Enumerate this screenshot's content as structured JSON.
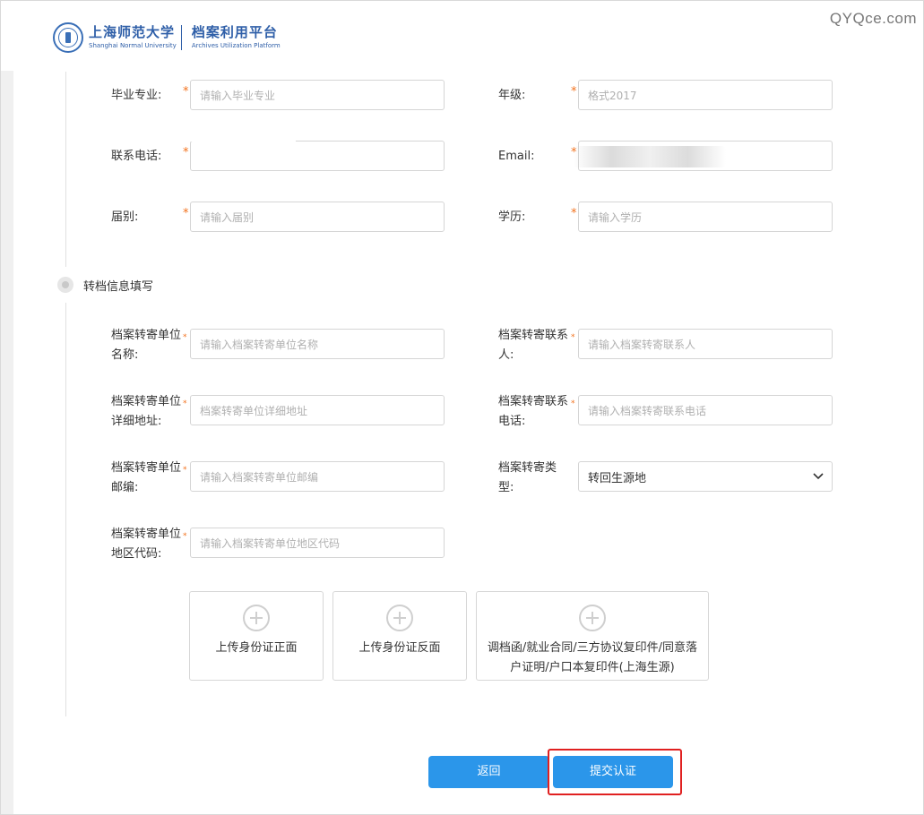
{
  "header": {
    "logo_cn": "上海师范大学",
    "platform_cn": "档案利用平台",
    "logo_en": "Shanghai Normal University",
    "platform_en": "Archives Utilization Platform",
    "watermark": "QYQce.com"
  },
  "required_mark": "*",
  "education_fields": {
    "major": {
      "label": "毕业专业:",
      "placeholder": "请输入毕业专业"
    },
    "grade": {
      "label": "年级:",
      "placeholder": "格式2017"
    },
    "phone": {
      "label": "联系电话:",
      "value": ""
    },
    "email": {
      "label": "Email:",
      "value": ""
    },
    "class_year": {
      "label": "届别:",
      "placeholder": "请输入届别"
    },
    "degree": {
      "label": "学历:",
      "placeholder": "请输入学历"
    }
  },
  "transfer_section": {
    "title": "转档信息填写",
    "unit_name": {
      "label": "档案转寄单位名称:",
      "placeholder": "请输入档案转寄单位名称"
    },
    "contact": {
      "label": "档案转寄联系人:",
      "placeholder": "请输入档案转寄联系人"
    },
    "address": {
      "label": "档案转寄单位详细地址:",
      "placeholder": "档案转寄单位详细地址"
    },
    "contact_phone": {
      "label": "档案转寄联系电话:",
      "placeholder": "请输入档案转寄联系电话"
    },
    "postcode": {
      "label": "档案转寄单位邮编:",
      "placeholder": "请输入档案转寄单位邮编"
    },
    "type": {
      "label": "档案转寄类型:",
      "selected": "转回生源地"
    },
    "region_code": {
      "label": "档案转寄单位地区代码:",
      "placeholder": "请输入档案转寄单位地区代码"
    }
  },
  "uploads": [
    {
      "label": "上传身份证正面"
    },
    {
      "label": "上传身份证反面"
    },
    {
      "label": "调档函/就业合同/三方协议复印件/同意落户证明/户口本复印件(上海生源)"
    }
  ],
  "buttons": {
    "back": "返回",
    "submit": "提交认证"
  },
  "colors": {
    "accent": "#2b96ea",
    "required": "#f2711c",
    "highlight": "#e02020",
    "brand": "#2f5fa8"
  }
}
